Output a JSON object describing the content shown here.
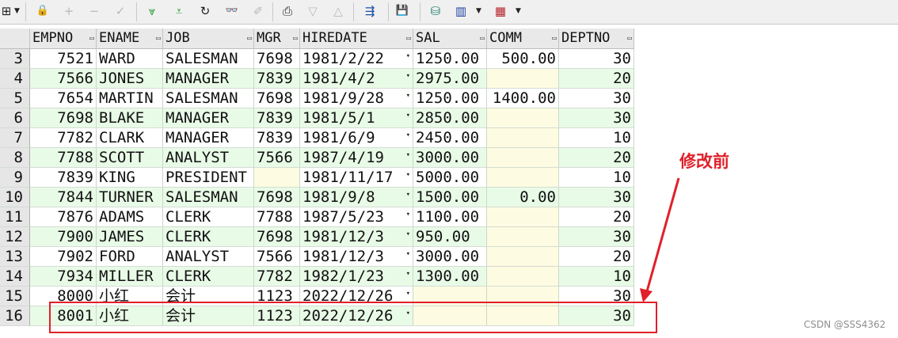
{
  "toolbar": {
    "icons": [
      "grid-icon",
      "lock-icon",
      "add-icon",
      "remove-icon",
      "confirm-icon",
      "filter-down-icon",
      "filter-icon",
      "refresh-icon",
      "find-icon",
      "clear-icon",
      "print-icon",
      "next-icon",
      "previous-icon",
      "link-icon",
      "save-icon",
      "query-icon",
      "chart-icon",
      "table-icon"
    ],
    "glyphs": {
      "grid": "⊞",
      "lock": "🔒",
      "add": "+",
      "remove": "−",
      "confirm": "✓",
      "filter_down": "⩔",
      "filter": "⩡",
      "refresh": "↻",
      "find": "👓",
      "clear": "✐",
      "print": "⎙",
      "next": "▽",
      "previous": "△",
      "link": "⇶",
      "save": "💾",
      "query": "⛁",
      "chart": "▥",
      "table": "▦",
      "caret": "▼"
    }
  },
  "grid": {
    "columns": [
      "EMPNO",
      "ENAME",
      "JOB",
      "MGR",
      "HIREDATE",
      "SAL",
      "COMM",
      "DEPTNO"
    ],
    "rows": [
      {
        "n": "3",
        "empno": "7521",
        "ename": "WARD",
        "job": "SALESMAN",
        "mgr": "7698",
        "hiredate": "1981/2/22",
        "sal": "1250.00",
        "comm": "500.00",
        "deptno": "30"
      },
      {
        "n": "4",
        "empno": "7566",
        "ename": "JONES",
        "job": "MANAGER",
        "mgr": "7839",
        "hiredate": "1981/4/2",
        "sal": "2975.00",
        "comm": "",
        "deptno": "20"
      },
      {
        "n": "5",
        "empno": "7654",
        "ename": "MARTIN",
        "job": "SALESMAN",
        "mgr": "7698",
        "hiredate": "1981/9/28",
        "sal": "1250.00",
        "comm": "1400.00",
        "deptno": "30"
      },
      {
        "n": "6",
        "empno": "7698",
        "ename": "BLAKE",
        "job": "MANAGER",
        "mgr": "7839",
        "hiredate": "1981/5/1",
        "sal": "2850.00",
        "comm": "",
        "deptno": "30"
      },
      {
        "n": "7",
        "empno": "7782",
        "ename": "CLARK",
        "job": "MANAGER",
        "mgr": "7839",
        "hiredate": "1981/6/9",
        "sal": "2450.00",
        "comm": "",
        "deptno": "10"
      },
      {
        "n": "8",
        "empno": "7788",
        "ename": "SCOTT",
        "job": "ANALYST",
        "mgr": "7566",
        "hiredate": "1987/4/19",
        "sal": "3000.00",
        "comm": "",
        "deptno": "20"
      },
      {
        "n": "9",
        "empno": "7839",
        "ename": "KING",
        "job": "PRESIDENT",
        "mgr": "",
        "hiredate": "1981/11/17",
        "sal": "5000.00",
        "comm": "",
        "deptno": "10"
      },
      {
        "n": "10",
        "empno": "7844",
        "ename": "TURNER",
        "job": "SALESMAN",
        "mgr": "7698",
        "hiredate": "1981/9/8",
        "sal": "1500.00",
        "comm": "0.00",
        "deptno": "30"
      },
      {
        "n": "11",
        "empno": "7876",
        "ename": "ADAMS",
        "job": "CLERK",
        "mgr": "7788",
        "hiredate": "1987/5/23",
        "sal": "1100.00",
        "comm": "",
        "deptno": "20"
      },
      {
        "n": "12",
        "empno": "7900",
        "ename": "JAMES",
        "job": "CLERK",
        "mgr": "7698",
        "hiredate": "1981/12/3",
        "sal": "950.00",
        "comm": "",
        "deptno": "30"
      },
      {
        "n": "13",
        "empno": "7902",
        "ename": "FORD",
        "job": "ANALYST",
        "mgr": "7566",
        "hiredate": "1981/12/3",
        "sal": "3000.00",
        "comm": "",
        "deptno": "20"
      },
      {
        "n": "14",
        "empno": "7934",
        "ename": "MILLER",
        "job": "CLERK",
        "mgr": "7782",
        "hiredate": "1982/1/23",
        "sal": "1300.00",
        "comm": "",
        "deptno": "10"
      },
      {
        "n": "15",
        "empno": "8000",
        "ename": "小红",
        "job": "会计",
        "mgr": "1123",
        "hiredate": "2022/12/26",
        "sal": "",
        "comm": "",
        "deptno": "30"
      },
      {
        "n": "16",
        "empno": "8001",
        "ename": "小红",
        "job": "会计",
        "mgr": "1123",
        "hiredate": "2022/12/26",
        "sal": "",
        "comm": "",
        "deptno": "30"
      }
    ],
    "colors": {
      "green_row": "#e8fbe6",
      "white_row": "#ffffff",
      "null_cell": "#fdfbe1",
      "header": "#e9e9e9"
    }
  },
  "annotation": {
    "label": "修改前",
    "color": "#e0202a"
  },
  "watermark": "CSDN @SSS4362"
}
